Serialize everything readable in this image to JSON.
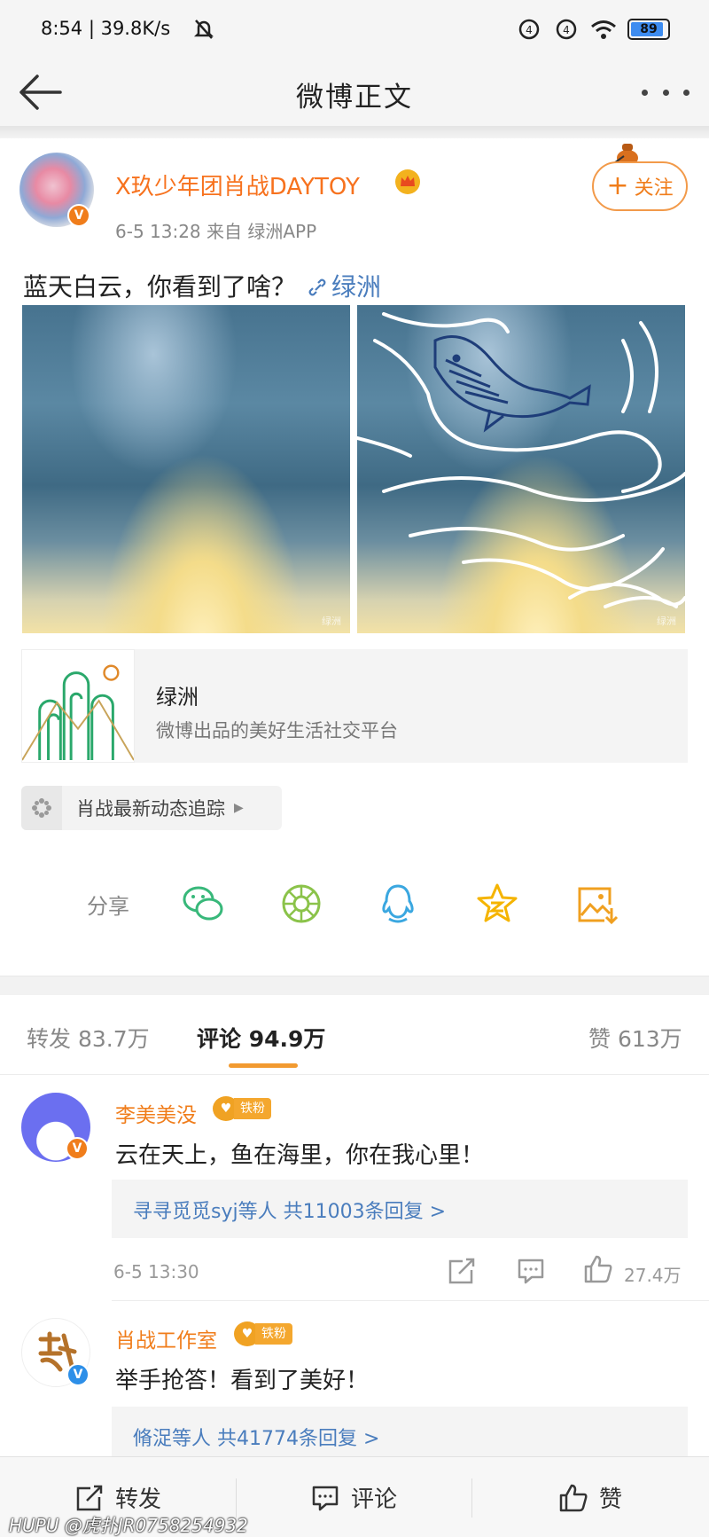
{
  "status_bar": {
    "time_speed": "8:54 | 39.8K/s",
    "battery": "89"
  },
  "nav": {
    "title": "微博正文"
  },
  "post": {
    "author": "X玖少年团肖战DAYTOY",
    "meta": "6-5 13:28   来自 绿洲APP",
    "follow_label": "关注",
    "text": "蓝天白云，你看到了啥？",
    "link_label": "绿洲",
    "photo_watermark": "绿洲",
    "link_card": {
      "title": "绿洲",
      "description": "微博出品的美好生活社交平台"
    },
    "topic_chip": "肖战最新动态追踪"
  },
  "share": {
    "label": "分享",
    "icons": [
      "wechat-icon",
      "moments-icon",
      "qq-icon",
      "qzone-icon",
      "save-image-icon"
    ]
  },
  "stats": {
    "repost": "转发 83.7万",
    "comment": "评论 94.9万",
    "like": "赞 613万"
  },
  "comments": [
    {
      "user": "李美美没",
      "badge": "铁粉",
      "text": "云在天上，鱼在海里，你在我心里！",
      "replies": "寻寻觅觅syj等人  共11003条回复 >",
      "time": "6-5 13:30",
      "likes": "27.4万"
    },
    {
      "user": "肖战工作室",
      "badge": "铁粉",
      "text": "举手抢答！看到了美好！",
      "replies": "脩浞等人  共41774条回复 >"
    }
  ],
  "bottom_bar": {
    "repost": "转发",
    "comment": "评论",
    "like": "赞"
  },
  "watermark": "HUPU @虎扑JR0758254932",
  "colors": {
    "accent_orange": "#f07d1b",
    "link_blue": "#4a7dbd",
    "tab_underline": "#f29a30"
  }
}
